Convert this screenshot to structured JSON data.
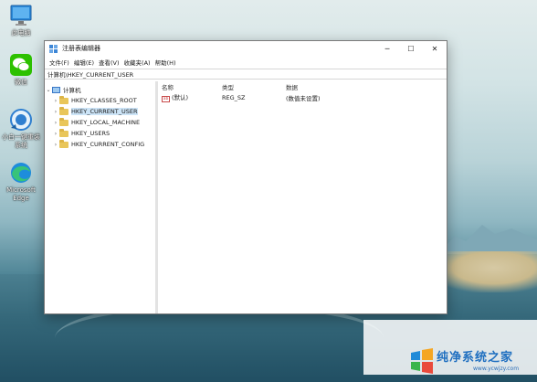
{
  "desktop": {
    "icons": [
      {
        "label": "此电脑",
        "icon": "this-pc-icon"
      },
      {
        "label": "微信",
        "icon": "wechat-icon"
      },
      {
        "label": "小白一键重装系统",
        "icon": "reinstall-tool-icon"
      },
      {
        "label": "Microsoft Edge",
        "icon": "edge-icon"
      }
    ]
  },
  "window": {
    "title": "注册表编辑器",
    "controls": {
      "minimize": "─",
      "maximize": "☐",
      "close": "✕"
    },
    "menu": [
      "文件(F)",
      "编辑(E)",
      "查看(V)",
      "收藏夹(A)",
      "帮助(H)"
    ],
    "address": "计算机\\HKEY_CURRENT_USER",
    "tree": {
      "root": "计算机",
      "children": [
        {
          "label": "HKEY_CLASSES_ROOT",
          "selected": false
        },
        {
          "label": "HKEY_CURRENT_USER",
          "selected": true
        },
        {
          "label": "HKEY_LOCAL_MACHINE",
          "selected": false
        },
        {
          "label": "HKEY_USERS",
          "selected": false
        },
        {
          "label": "HKEY_CURRENT_CONFIG",
          "selected": false
        }
      ]
    },
    "list": {
      "columns": [
        "名称",
        "类型",
        "数据"
      ],
      "rows": [
        {
          "name": "(默认)",
          "type": "REG_SZ",
          "data": "(数值未设置)"
        }
      ]
    }
  },
  "watermark": {
    "brand": "纯净系统之家",
    "url": "www.ycwjzy.com"
  },
  "colors": {
    "selection": "#cce4f7",
    "folder": "#e9c65a",
    "brand": "#1f6fc0"
  }
}
